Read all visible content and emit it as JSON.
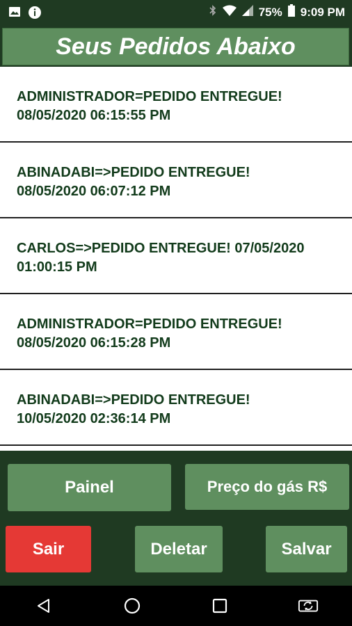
{
  "status": {
    "battery": "75%",
    "time": "9:09 PM",
    "icons": [
      "image-icon",
      "info-icon",
      "bluetooth-icon",
      "wifi-icon",
      "signal-icon",
      "battery-icon"
    ]
  },
  "header": {
    "title": "Seus Pedidos Abaixo"
  },
  "orders": [
    {
      "line1": "ADMINISTRADOR=PEDIDO ENTREGUE!",
      "line2": "08/05/2020 06:15:55 PM"
    },
    {
      "line1": "ABINADABI=>PEDIDO ENTREGUE!",
      "line2": "08/05/2020 06:07:12 PM"
    },
    {
      "line1": "CARLOS=>PEDIDO ENTREGUE! 07/05/2020",
      "line2": "01:00:15 PM"
    },
    {
      "line1": "ADMINISTRADOR=PEDIDO ENTREGUE!",
      "line2": "08/05/2020 06:15:28 PM"
    },
    {
      "line1": "ABINADABI=>PEDIDO ENTREGUE!",
      "line2": "10/05/2020 02:36:14 PM"
    }
  ],
  "buttons": {
    "painel": "Painel",
    "preco": "Preço do gás R$",
    "sair": "Sair",
    "deletar": "Deletar",
    "salvar": "Salvar"
  },
  "colors": {
    "background": "#1f3a22",
    "button": "#5f8f5f",
    "sair": "#e53935",
    "text": "#123b1b"
  },
  "navbar": {
    "icons": [
      "back-icon",
      "home-icon",
      "recents-icon",
      "rotate-icon"
    ]
  }
}
